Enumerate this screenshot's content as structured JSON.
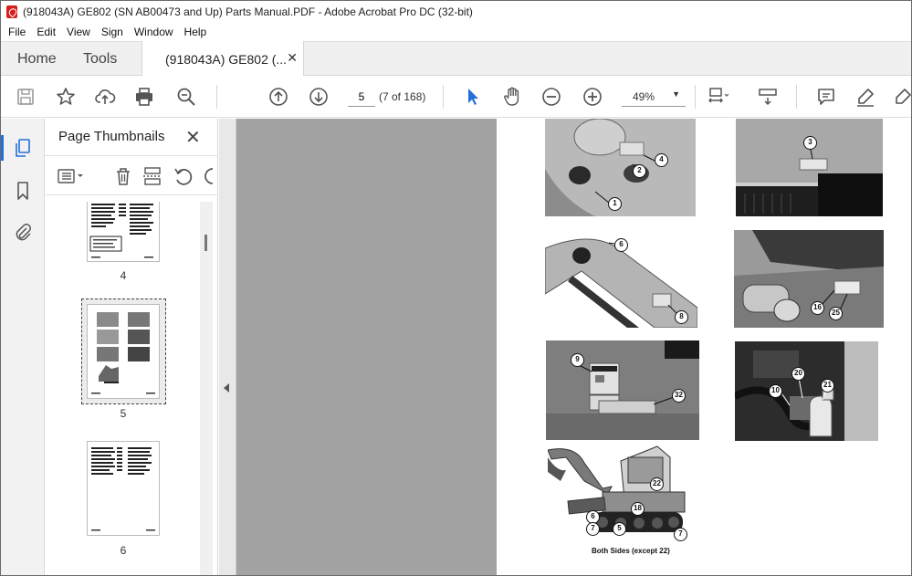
{
  "window": {
    "title": "(918043A) GE802 (SN AB00473 and Up) Parts Manual.PDF - Adobe Acrobat Pro DC (32-bit)"
  },
  "menu": [
    "File",
    "Edit",
    "View",
    "Sign",
    "Window",
    "Help"
  ],
  "tabs": {
    "home": "Home",
    "tools": "Tools",
    "document": "(918043A) GE802 (..."
  },
  "toolbar": {
    "page_number": "5",
    "page_count": "(7 of 168)",
    "zoom": "49%"
  },
  "thumbnails_panel": {
    "title": "Page Thumbnails",
    "pages": [
      "4",
      "5",
      "6"
    ],
    "selected_page": "5"
  },
  "document": {
    "callouts": [
      "1",
      "2",
      "4",
      "3",
      "6",
      "8",
      "16",
      "25",
      "9",
      "32",
      "10",
      "20",
      "21",
      "22",
      "6",
      "18",
      "7",
      "5",
      "7"
    ],
    "caption": "Both Sides (except 22)"
  },
  "colors": {
    "accent": "#2470d9",
    "app_icon": "#d71e1e",
    "doc_background": "#a3a3a3"
  }
}
